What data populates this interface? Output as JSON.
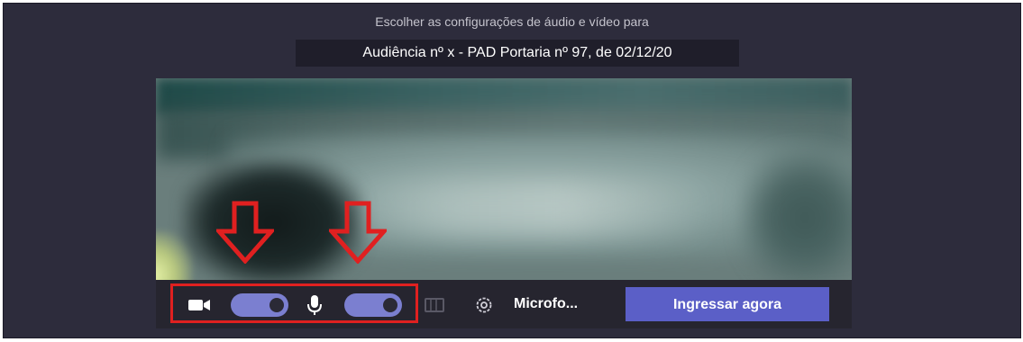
{
  "dialog": {
    "subtitle": "Escolher as configurações de áudio e vídeo para",
    "meeting_title": "Audiência nº x - PAD Portaria nº 97, de 02/12/20"
  },
  "toolbar": {
    "camera_icon": "video-camera-icon",
    "camera_toggle_state": "on",
    "mic_icon": "microphone-icon",
    "mic_toggle_state": "on",
    "background_icon": "background-effects-icon",
    "settings_icon": "gear-icon",
    "audio_device_label": "Microfo...",
    "join_button_label": "Ingressar agora"
  },
  "annotations": {
    "arrow_color": "#e02020",
    "box_color": "#e02020",
    "arrow_icon": "down-arrow-icon"
  },
  "colors": {
    "background": "#2d2c3c",
    "toggle_on": "#7b7fd0",
    "join_button": "#5b5fc7"
  }
}
